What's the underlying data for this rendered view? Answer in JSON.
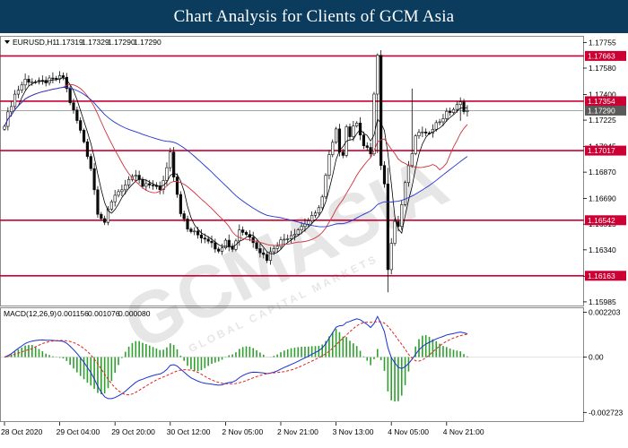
{
  "banner": {
    "title": "Chart Analysis for Clients of GCM Asia"
  },
  "watermark": {
    "text": "GCMASIA",
    "subtext": "GLOBAL CAPITAL MARKETS"
  },
  "colors": {
    "banner": "#0b3c5d",
    "level_line": "#cc0033",
    "price_marker": "#5a5a5a",
    "up_candle": "#ffffff",
    "down_candle": "#0b0b0b",
    "ma_fast": "#000000",
    "ma_mid": "#d03040",
    "ma_slow": "#2233cc",
    "macd_line": "#1a2fd0",
    "signal_line": "#e02020",
    "histogram": "#2ea02e"
  },
  "chart_data": [
    {
      "type": "candlestick",
      "symbol": "EURUSD,H1",
      "ohlc_header": {
        "open": "1.17319",
        "high": "1.17329",
        "low": "1.17290",
        "close": "1.17290"
      },
      "ylim": [
        1.1596,
        1.178
      ],
      "y_ticks": [
        "1.17755",
        "1.17580",
        "1.17400",
        "1.17225",
        "1.17045",
        "1.16870",
        "1.16690",
        "1.16515",
        "1.16340",
        "1.16160",
        "1.15985"
      ],
      "x_ticks": [
        "28 Oct 2020",
        "29 Oct 04:00",
        "29 Oct 20:00",
        "30 Oct 12:00",
        "2 Nov 05:00",
        "2 Nov 21:00",
        "3 Nov 13:00",
        "4 Nov 05:00",
        "4 Nov 21:00"
      ],
      "x_tick_bars": [
        0,
        16,
        32,
        48,
        64,
        80,
        96,
        112,
        128
      ],
      "levels": [
        {
          "price": 1.17663,
          "label": "1.17663"
        },
        {
          "price": 1.17354,
          "label": "1.17354"
        },
        {
          "price": 1.17017,
          "label": "1.17017"
        },
        {
          "price": 1.16542,
          "label": "1.16542"
        },
        {
          "price": 1.16163,
          "label": "1.16163"
        }
      ],
      "current_price": {
        "price": 1.1729,
        "label": "1.17290"
      },
      "price_anchors": [
        [
          0,
          1.172
        ],
        [
          3,
          1.174
        ],
        [
          6,
          1.175
        ],
        [
          10,
          1.1748
        ],
        [
          14,
          1.175
        ],
        [
          17,
          1.1752
        ],
        [
          19,
          1.1735
        ],
        [
          21,
          1.1722
        ],
        [
          23,
          1.1708
        ],
        [
          25,
          1.169
        ],
        [
          27,
          1.166
        ],
        [
          29,
          1.1653
        ],
        [
          30,
          1.166
        ],
        [
          32,
          1.1672
        ],
        [
          35,
          1.1678
        ],
        [
          38,
          1.1685
        ],
        [
          40,
          1.1677
        ],
        [
          43,
          1.1679
        ],
        [
          45,
          1.1674
        ],
        [
          47,
          1.169
        ],
        [
          48,
          1.1702
        ],
        [
          49,
          1.1685
        ],
        [
          51,
          1.166
        ],
        [
          53,
          1.1648
        ],
        [
          57,
          1.1643
        ],
        [
          60,
          1.164
        ],
        [
          62,
          1.1632
        ],
        [
          64,
          1.1642
        ],
        [
          66,
          1.1634
        ],
        [
          68,
          1.1648
        ],
        [
          70,
          1.1645
        ],
        [
          72,
          1.164
        ],
        [
          74,
          1.1633
        ],
        [
          76,
          1.1628
        ],
        [
          78,
          1.1636
        ],
        [
          80,
          1.164
        ],
        [
          82,
          1.1643
        ],
        [
          84,
          1.1646
        ],
        [
          86,
          1.165
        ],
        [
          88,
          1.1654
        ],
        [
          90,
          1.1658
        ],
        [
          92,
          1.167
        ],
        [
          94,
          1.1698
        ],
        [
          96,
          1.1715
        ],
        [
          97,
          1.1702
        ],
        [
          98,
          1.17
        ],
        [
          99,
          1.1718
        ],
        [
          100,
          1.1712
        ],
        [
          102,
          1.1722
        ],
        [
          104,
          1.1705
        ],
        [
          106,
          1.17
        ],
        [
          107,
          1.174
        ],
        [
          108,
          1.1766
        ],
        [
          109,
          1.169
        ],
        [
          110,
          1.168
        ],
        [
          111,
          1.162
        ],
        [
          112,
          1.164
        ],
        [
          113,
          1.1655
        ],
        [
          114,
          1.165
        ],
        [
          115,
          1.1665
        ],
        [
          116,
          1.168
        ],
        [
          117,
          1.169
        ],
        [
          118,
          1.17
        ],
        [
          119,
          1.171
        ],
        [
          120,
          1.1715
        ],
        [
          122,
          1.1712
        ],
        [
          124,
          1.1718
        ],
        [
          126,
          1.1722
        ],
        [
          128,
          1.1727
        ],
        [
          130,
          1.173
        ],
        [
          132,
          1.1734
        ],
        [
          133,
          1.173
        ],
        [
          134,
          1.1729
        ]
      ],
      "wicks": [
        [
          108,
          1.1768,
          1.17
        ],
        [
          111,
          1.169,
          1.1605
        ],
        [
          118,
          1.1744,
          1.169
        ],
        [
          132,
          1.1738,
          1.1722
        ]
      ]
    },
    {
      "type": "macd",
      "label": "MACD(12,26,9)",
      "values": {
        "macd": "0.001156",
        "signal": "0.001076",
        "histogram": "0.000080"
      },
      "ylim": [
        -0.00315,
        0.00245
      ],
      "y_ticks": [
        {
          "value": 0.002203,
          "label": "0.002203"
        },
        {
          "value": 0.0,
          "label": "0.00"
        },
        {
          "value": -0.002723,
          "label": "-0.002723"
        }
      ]
    }
  ]
}
